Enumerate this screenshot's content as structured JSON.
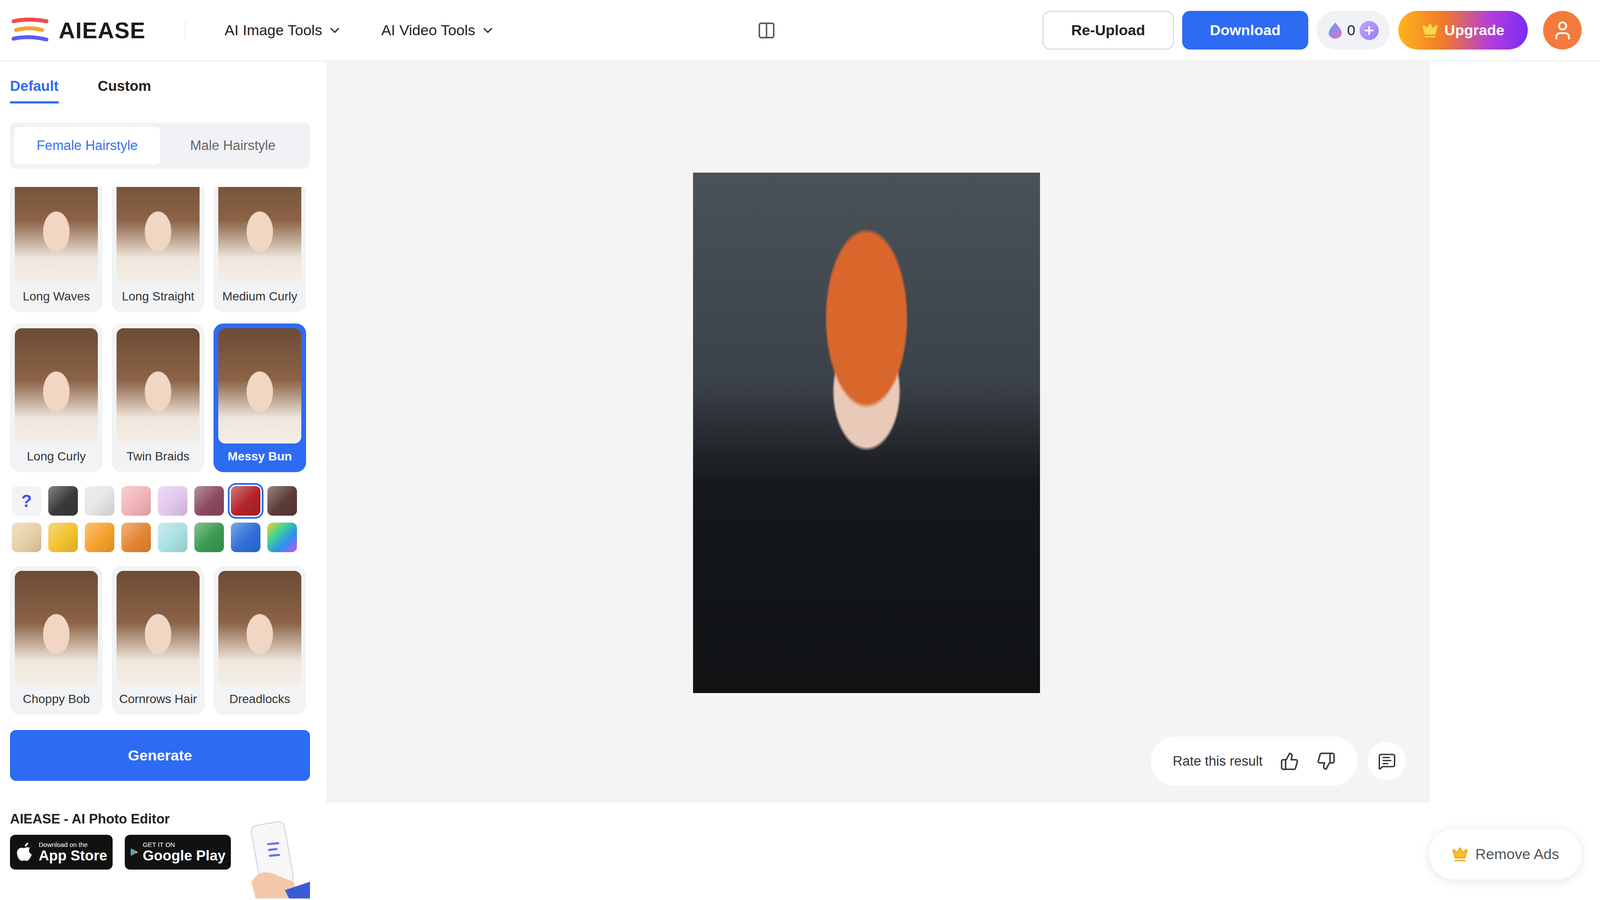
{
  "header": {
    "logo": "AIEASE",
    "nav": [
      {
        "label": "AI Image Tools"
      },
      {
        "label": "AI Video Tools"
      }
    ],
    "reupload": "Re-Upload",
    "download": "Download",
    "credits": "0",
    "upgrade": "Upgrade"
  },
  "sidebar": {
    "tabs": [
      {
        "label": "Default",
        "selected": true
      },
      {
        "label": "Custom",
        "selected": false
      }
    ],
    "gender": [
      {
        "label": "Female Hairstyle",
        "selected": true
      },
      {
        "label": "Male Hairstyle",
        "selected": false
      }
    ],
    "hairstyles": [
      {
        "name": "Long Waves",
        "selected": false
      },
      {
        "name": "Long Straight",
        "selected": false
      },
      {
        "name": "Medium Curly",
        "selected": false
      },
      {
        "name": "Long Curly",
        "selected": false
      },
      {
        "name": "Twin Braids",
        "selected": false
      },
      {
        "name": "Messy Bun",
        "selected": true
      },
      {
        "name": "Choppy Bob",
        "selected": false
      },
      {
        "name": "Cornrows Hair",
        "selected": false
      },
      {
        "name": "Dreadlocks",
        "selected": false
      }
    ],
    "colors": [
      {
        "kind": "random",
        "label": "?",
        "selected": false
      },
      {
        "kind": "solid",
        "color": "#3a3a3a",
        "selected": false
      },
      {
        "kind": "solid",
        "color": "#e4e4e4",
        "selected": false
      },
      {
        "kind": "solid",
        "color": "#f2b3b6",
        "selected": false
      },
      {
        "kind": "solid",
        "color": "#e2c6ec",
        "selected": false
      },
      {
        "kind": "solid",
        "color": "#8c4a60",
        "selected": false
      },
      {
        "kind": "solid",
        "color": "#b3242a",
        "selected": true
      },
      {
        "kind": "solid",
        "color": "#5c3b37",
        "selected": false
      },
      {
        "kind": "solid",
        "color": "#e6cfa4",
        "selected": false
      },
      {
        "kind": "solid",
        "color": "#f2c22e",
        "selected": false
      },
      {
        "kind": "solid",
        "color": "#f6a02c",
        "selected": false
      },
      {
        "kind": "solid",
        "color": "#e48634",
        "selected": false
      },
      {
        "kind": "solid",
        "color": "#a9e0e2",
        "selected": false
      },
      {
        "kind": "solid",
        "color": "#3b9a52",
        "selected": false
      },
      {
        "kind": "solid",
        "color": "#2f6fd8",
        "selected": false
      },
      {
        "kind": "rainbow",
        "selected": false
      }
    ],
    "generate": "Generate",
    "promo": {
      "title": "AIEASE - AI Photo Editor",
      "badges": [
        {
          "kind": "apple",
          "small": "Download on the",
          "big": "App Store"
        },
        {
          "kind": "google",
          "small": "GET IT ON",
          "big": "Google Play"
        }
      ]
    }
  },
  "canvas": {
    "rate": "Rate this result"
  },
  "remove_ads": "Remove Ads"
}
